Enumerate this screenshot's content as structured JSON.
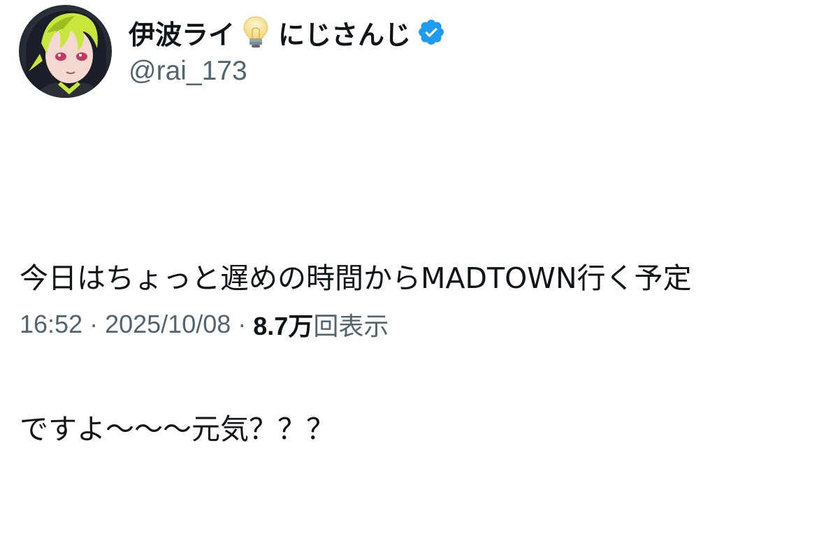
{
  "author": {
    "display_name": "伊波ライ",
    "name_emoji": "lightbulb-icon",
    "affiliation": "にじさんじ",
    "handle": "@rai_173",
    "verified_icon": "verified-badge-icon",
    "verified_color": "#1d9bf0"
  },
  "tweet": {
    "text_line_1": "今日はちょっと遅めの時間からMADTOWN行く予定",
    "text_line_2": "ですよ〜〜〜元気？？？"
  },
  "meta": {
    "time": "16:52",
    "separator": "·",
    "date": "2025/10/08",
    "views_count": "8.7万",
    "views_label": "回表示"
  },
  "colors": {
    "text": "#0f1419",
    "secondary": "#536471",
    "background": "#ffffff",
    "accent": "#1d9bf0",
    "avatar_hair": "#c8e63c"
  }
}
